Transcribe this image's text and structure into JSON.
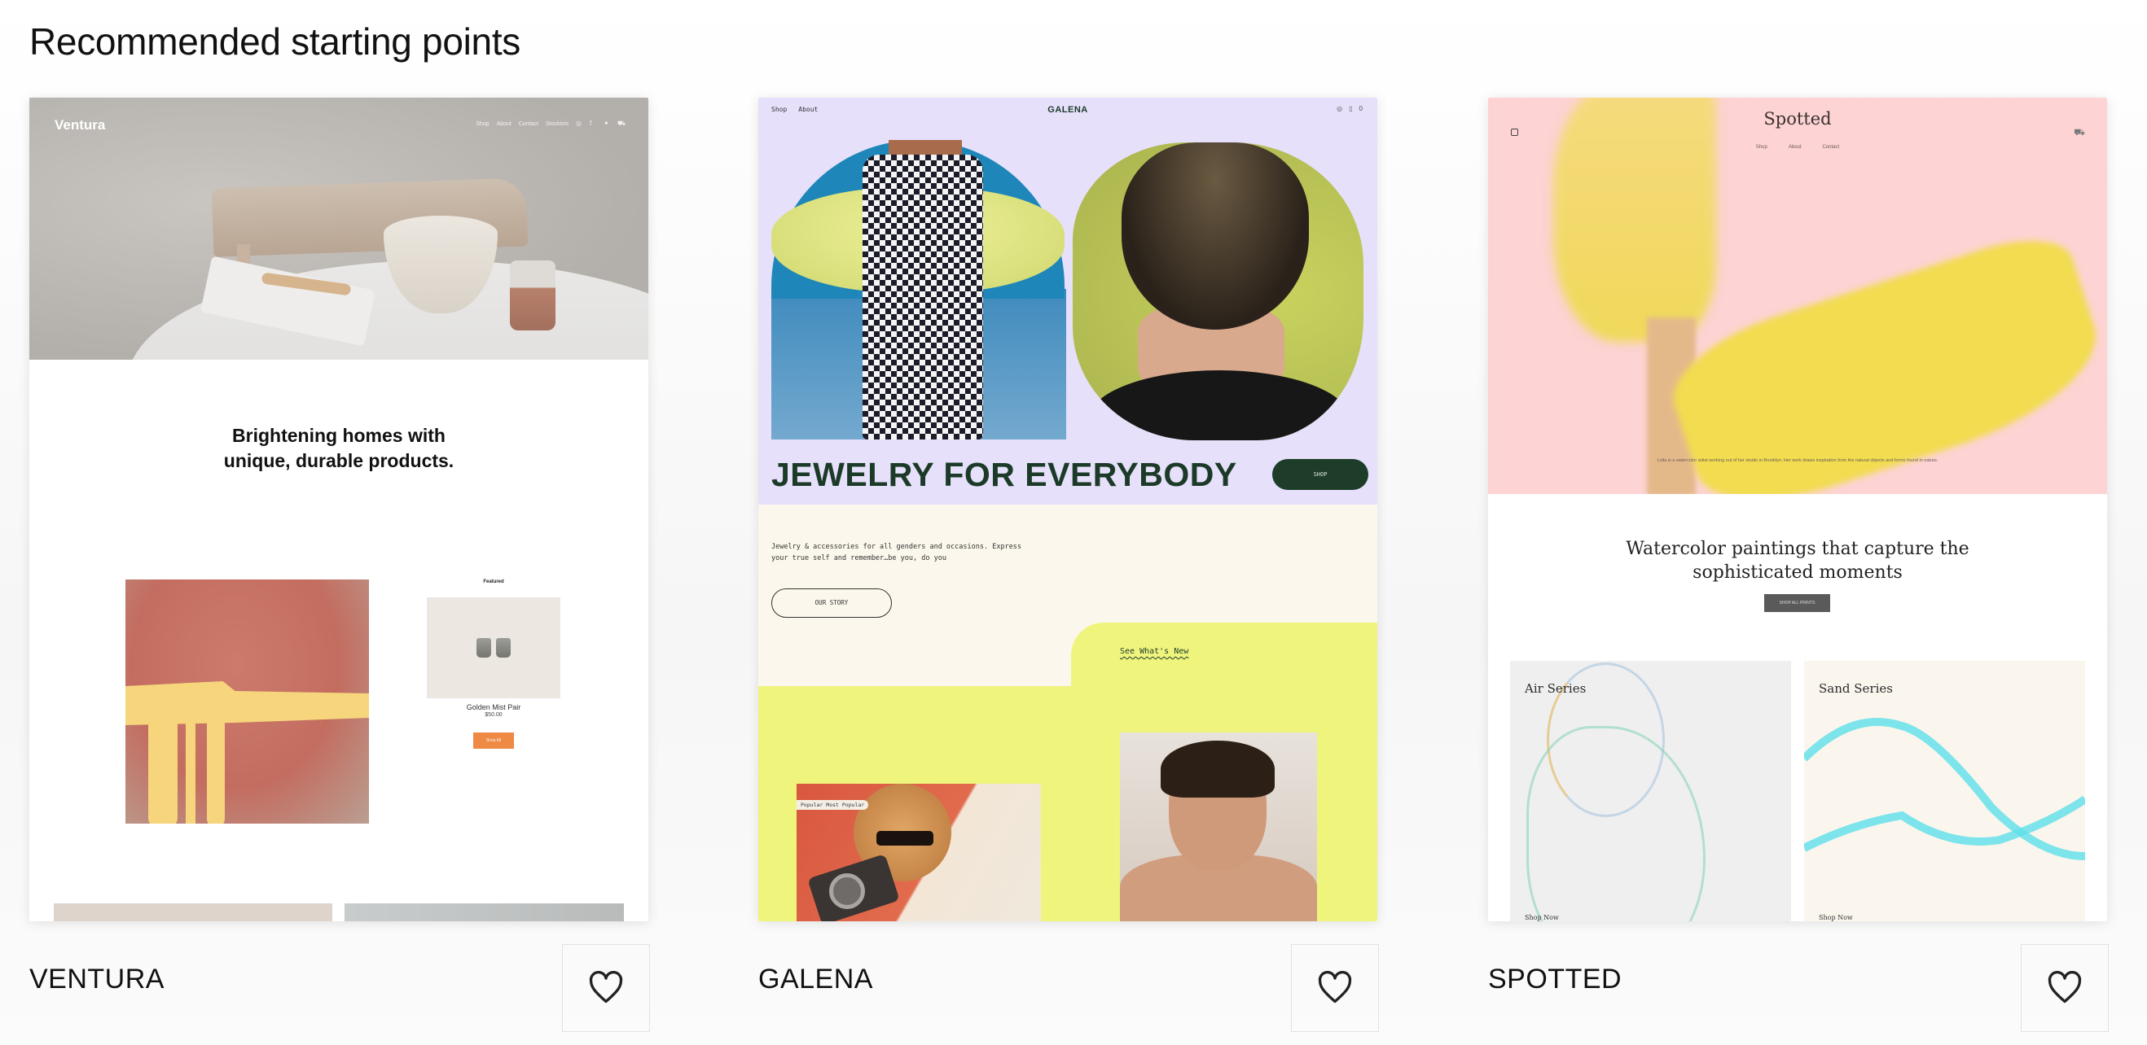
{
  "page": {
    "title": "Recommended starting points"
  },
  "templates": [
    {
      "name": "VENTURA",
      "favorite_icon": "heart-outline-icon",
      "preview": {
        "logo": "Ventura",
        "nav": [
          "Shop",
          "About",
          "Contact",
          "Stockists"
        ],
        "nav_icons": [
          "instagram-icon",
          "facebook-icon",
          "twitter-icon",
          "cart-icon"
        ],
        "headline_line1": "Brightening homes with",
        "headline_line2": "unique, durable products.",
        "featured_label": "Featured",
        "product_name": "Golden Mist Pair",
        "product_price": "$50.00",
        "button": "Shop All",
        "accent_color": "#ef8a45"
      }
    },
    {
      "name": "GALENA",
      "favorite_icon": "heart-outline-icon",
      "preview": {
        "logo": "GALENA",
        "nav": [
          "Shop",
          "About"
        ],
        "cart_count": "0",
        "headline": "JEWELRY FOR EVERYBODY",
        "shop_button": "SHOP",
        "description": "Jewelry & accessories for all genders and occasions. Express your true self and remember…be you, do you",
        "story_button": "OUR STORY",
        "see_new_link": "See What's New",
        "tag": "Popular   Most Popular",
        "accent_color": "#1d3d29",
        "bg_colors": [
          "#e6e0fb",
          "#fcf7ec",
          "#eff47d"
        ]
      }
    },
    {
      "name": "SPOTTED",
      "favorite_icon": "heart-outline-icon",
      "preview": {
        "logo": "Spotted",
        "nav": [
          "Shop",
          "About",
          "Contact"
        ],
        "bio": "Lolla is a watercolor artist working out of her studio in Brooklyn. Her work draws inspiration from the natural objects and forms found in nature.",
        "headline_line1": "Watercolor paintings that capture the",
        "headline_line2": "sophisticated moments",
        "button": "SHOP ALL PRINTS",
        "tiles": [
          {
            "title": "Air Series",
            "link": "Shop Now"
          },
          {
            "title": "Sand Series",
            "link": "Shop Now"
          }
        ],
        "accent_color": "#fdd3d3"
      }
    }
  ]
}
